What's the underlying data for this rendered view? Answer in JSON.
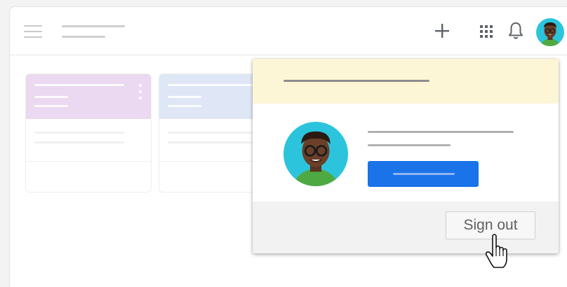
{
  "app": {
    "header": {
      "menu_icon": "hamburger-menu-icon",
      "create_icon": "plus-icon",
      "apps_icon": "apps-grid-icon",
      "notifications_icon": "bell-icon",
      "account_icon": "avatar"
    },
    "cards": [
      {
        "header_color": "#ead9f0"
      },
      {
        "header_color": "#dfe7f7"
      }
    ]
  },
  "account_popup": {
    "banner_color": "#fcf6d6",
    "primary_button_color": "#1a73e8",
    "sign_out_label": "Sign out"
  },
  "cursor": {
    "icon": "hand-pointer-icon"
  }
}
